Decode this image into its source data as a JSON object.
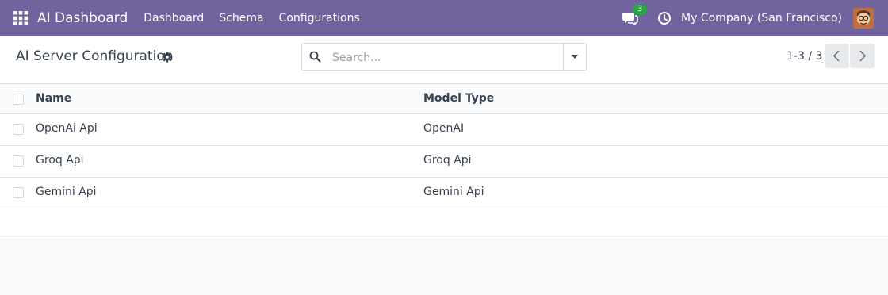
{
  "navbar": {
    "app_title": "AI Dashboard",
    "menu": [
      {
        "label": "Dashboard"
      },
      {
        "label": "Schema"
      },
      {
        "label": "Configurations"
      }
    ],
    "chat_count": "3",
    "company": "My Company (San Francisco)",
    "color": "#71639e"
  },
  "control_panel": {
    "title": "AI Server Configuration",
    "search_placeholder": "Search...",
    "pager": "1-3 / 3"
  },
  "list": {
    "columns": [
      "Name",
      "Model Type"
    ],
    "rows": [
      {
        "name": "OpenAi Api",
        "model_type": "OpenAI"
      },
      {
        "name": "Groq Api",
        "model_type": "Groq Api"
      },
      {
        "name": "Gemini Api",
        "model_type": "Gemini Api"
      }
    ]
  }
}
